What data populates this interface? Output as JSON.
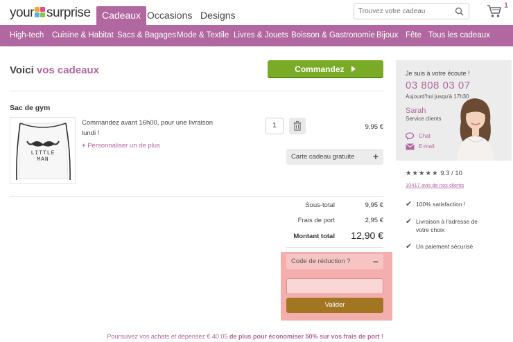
{
  "header": {
    "logo_left": "your",
    "logo_right": "surprise",
    "tabs": [
      {
        "label": "Cadeaux",
        "active": true
      },
      {
        "label": "Occasions",
        "active": false
      },
      {
        "label": "Designs",
        "active": false
      }
    ],
    "search_placeholder": "Trouvez votre cadeau",
    "cart_count": "1"
  },
  "nav": {
    "items": [
      "High-tech",
      "Cuisine & Habitat",
      "Sacs & Bagages",
      "Mode & Textile",
      "Livres & Jouets",
      "Boisson & Gastronomie",
      "Bijoux",
      "Fête",
      "Tous les cadeaux"
    ]
  },
  "main": {
    "heading_prefix": "Voici",
    "heading_accent": "vos cadeaux",
    "order_button": "Commandez"
  },
  "product": {
    "title": "Sac de gym",
    "bag_text": "LITTLE MAN",
    "delivery_text": "Commandez avant 16h00, pour une livraison lundi !",
    "personalize_link": "Personnaliser un de plus",
    "quantity": "1",
    "price": "9,95 €",
    "giftcard_label": "Carte cadeau gratuite"
  },
  "summary": {
    "subtotal_label": "Sous-total",
    "subtotal_value": "9,95 €",
    "shipping_label": "Frais de port",
    "shipping_value": "2,95 €",
    "total_label": "Montant total",
    "total_value": "12,90 €"
  },
  "promo": {
    "header_label": "Code de réduction ?",
    "input_value": "",
    "button_label": "Valider"
  },
  "shipping_note": {
    "prefix": "Poursuivez vos achats et dépensez € 40.05 ",
    "bold": "de plus pour économiser 50% sur vos frais de port !"
  },
  "sidebar": {
    "listening": "Je suis à votre écoute !",
    "phone": "03 808 03 07",
    "hours": "Aujourd'hui jusqu'à 17h30",
    "agent_name": "Sarah",
    "agent_role": "Service clients",
    "chat_label": "Chat",
    "email_label": "E-mail",
    "stars": "★★★★★",
    "rating": "9.3 / 10",
    "reviews_link": "10417 avis de nos clients",
    "usps": [
      "100% satisfaction !",
      "Livraison à l'adresse de votre choix",
      "Un paiement sécurisé"
    ]
  },
  "colors": {
    "brand": "#b1679f",
    "order_button": "#7aab26",
    "validate_button": "#a27523",
    "promo_highlight": "#f5aeae"
  }
}
